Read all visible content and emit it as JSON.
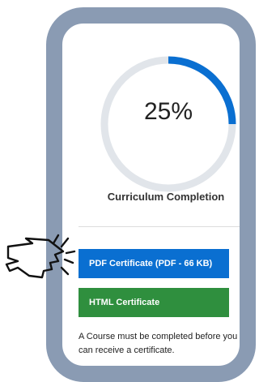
{
  "progress": {
    "value": 0.25,
    "label": "25%",
    "caption": "Curriculum Completion"
  },
  "certificates": {
    "pdf_label": "PDF Certificate (PDF - 66 KB)",
    "html_label": "HTML Certificate"
  },
  "note": "A Course must be completed before you can receive a certificate.",
  "colors": {
    "accent": "#0a6fd1",
    "track": "#e1e5ea",
    "html_button": "#2f8f3e",
    "frame": "#8a9bb3"
  },
  "icons": {
    "pointer": "pointing-hand-icon"
  }
}
